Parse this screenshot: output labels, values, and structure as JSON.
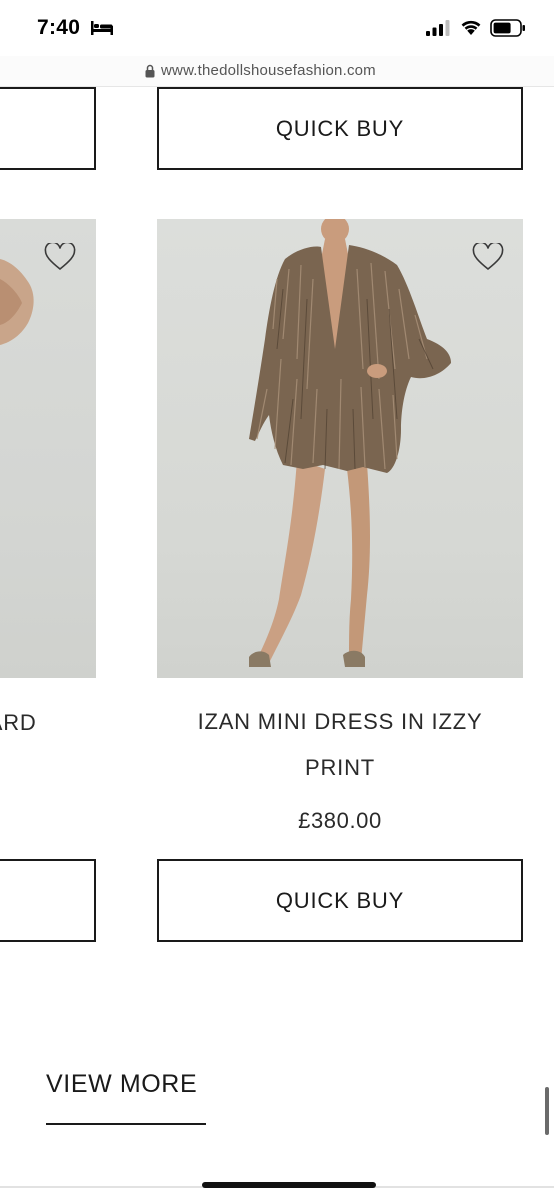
{
  "status_bar": {
    "time": "7:40",
    "icons": [
      "bed-icon",
      "signal-icon",
      "wifi-icon",
      "battery-icon"
    ]
  },
  "browser": {
    "url": "www.thedollshousefashion.com",
    "lock_icon": "lock-icon"
  },
  "top_buttons": {
    "left_label": "",
    "right_label": "QUICK BUY"
  },
  "products": [
    {
      "title_visible": "OPARD",
      "wishlist_icon": "heart-icon"
    },
    {
      "title": "IZAN MINI DRESS IN IZZY PRINT",
      "title_line1": "IZAN MINI DRESS IN IZZY",
      "title_line2": "PRINT",
      "price": "£380.00",
      "wishlist_icon": "heart-icon"
    }
  ],
  "bottom_buttons": {
    "left_label": "",
    "right_label": "QUICK BUY"
  },
  "view_more": "VIEW MORE",
  "colors": {
    "text": "#1a1a1a",
    "image_bg": "#d9dbd8",
    "dress": "#7a6550"
  }
}
